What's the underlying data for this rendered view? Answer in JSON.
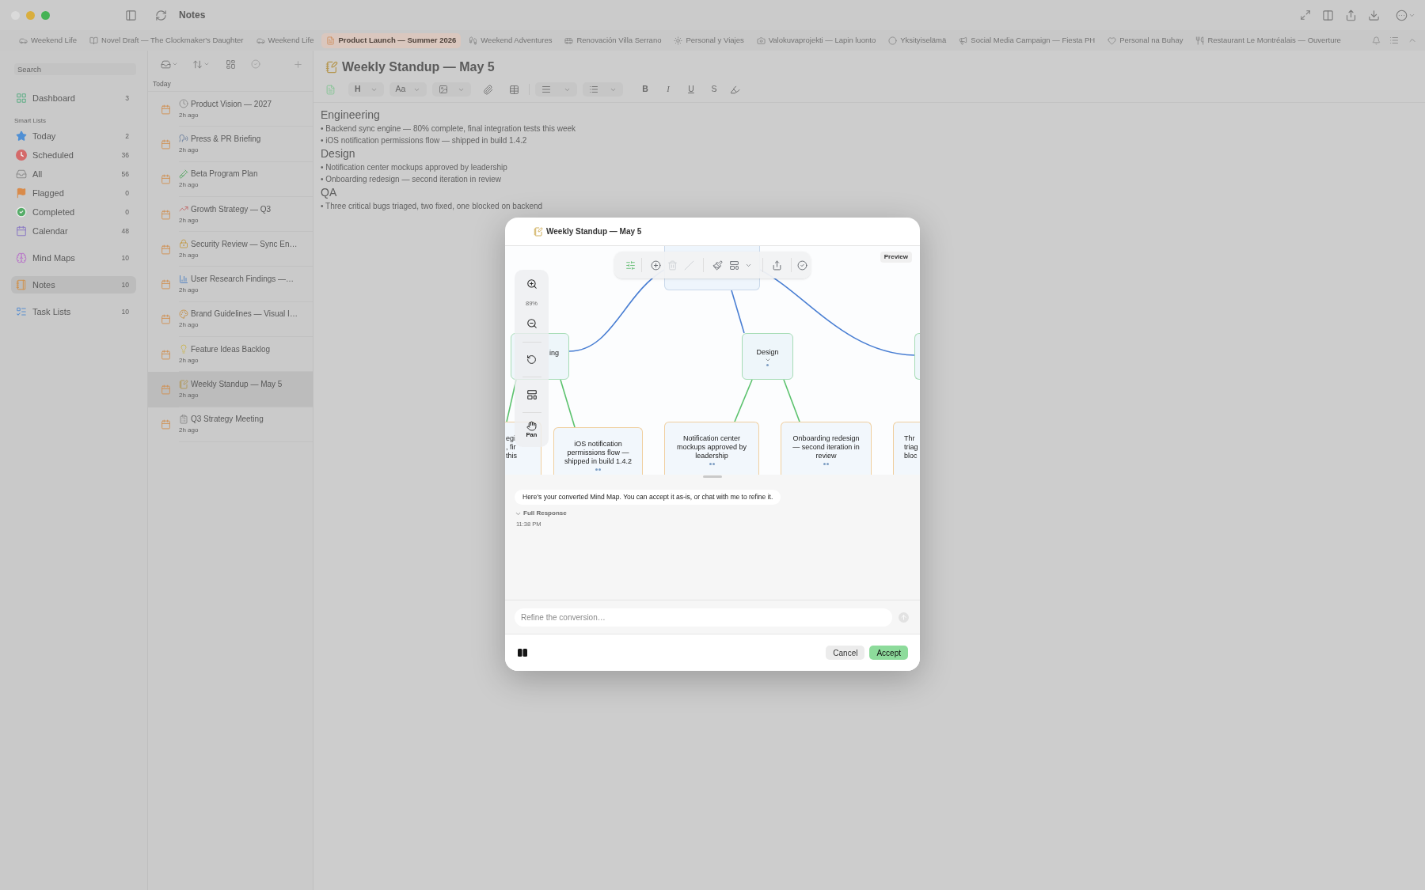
{
  "window": {
    "title": "Notes"
  },
  "tabs": [
    {
      "label": "Weekend Life",
      "selected": false
    },
    {
      "label": "Novel Draft — The Clockmaker's Daughter",
      "selected": false
    },
    {
      "label": "Weekend Life",
      "selected": false
    },
    {
      "label": "Product Launch — Summer 2026",
      "selected": true
    },
    {
      "label": "Weekend Adventures",
      "selected": false
    },
    {
      "label": "Renovación Villa Serrano",
      "selected": false
    },
    {
      "label": "Personal y Viajes",
      "selected": false
    },
    {
      "label": "Valokuvaprojekti — Lapin luonto",
      "selected": false
    },
    {
      "label": "Yksityiselämä",
      "selected": false
    },
    {
      "label": "Social Media Campaign — Fiesta PH",
      "selected": false
    },
    {
      "label": "Personal na Buhay",
      "selected": false
    },
    {
      "label": "Restaurant Le Montréalais — Ouverture",
      "selected": false
    }
  ],
  "sidebar": {
    "search": {
      "placeholder": "Search"
    },
    "groups": [
      {
        "items": [
          {
            "label": "Dashboard",
            "count": "3",
            "selected": false
          }
        ]
      },
      {
        "heading": "Smart Lists",
        "items": [
          {
            "label": "Today",
            "count": "2",
            "selected": false
          },
          {
            "label": "Scheduled",
            "count": "36",
            "selected": false
          },
          {
            "label": "All",
            "count": "56",
            "selected": false
          },
          {
            "label": "Flagged",
            "count": "0",
            "selected": false
          },
          {
            "label": "Completed",
            "count": "0",
            "selected": false
          },
          {
            "label": "Calendar",
            "count": "48",
            "selected": false
          }
        ]
      },
      {
        "items": [
          {
            "label": "Mind Maps",
            "count": "10",
            "selected": false
          }
        ]
      },
      {
        "items": [
          {
            "label": "Notes",
            "count": "10",
            "selected": true
          }
        ]
      },
      {
        "items": [
          {
            "label": "Task Lists",
            "count": "10",
            "selected": false
          }
        ]
      }
    ]
  },
  "notes_list": {
    "section": "Today",
    "items": [
      {
        "title": "Product Vision — 2027",
        "time": "2h ago",
        "selected": false
      },
      {
        "title": "Press & PR Briefing",
        "time": "2h ago",
        "selected": false
      },
      {
        "title": "Beta Program Plan",
        "time": "2h ago",
        "selected": false
      },
      {
        "title": "Growth Strategy — Q3",
        "time": "2h ago",
        "selected": false
      },
      {
        "title": "Security Review — Sync En…",
        "time": "2h ago",
        "selected": false
      },
      {
        "title": "User Research Findings —…",
        "time": "2h ago",
        "selected": false
      },
      {
        "title": "Brand Guidelines — Visual I…",
        "time": "2h ago",
        "selected": false
      },
      {
        "title": "Feature Ideas Backlog",
        "time": "2h ago",
        "selected": false
      },
      {
        "title": "Weekly Standup — May 5",
        "time": "2h ago",
        "selected": true
      },
      {
        "title": "Q3 Strategy Meeting",
        "time": "2h ago",
        "selected": false
      }
    ]
  },
  "editor": {
    "title": "Weekly Standup — May 5",
    "toolbar": {
      "heading_menu": "H",
      "font_menu": "Aa",
      "styles": [
        "B",
        "I",
        "U",
        "S"
      ]
    },
    "content": [
      {
        "kind": "heading",
        "text": "Engineering"
      },
      {
        "kind": "bullet",
        "text": "• Backend sync engine — 80% complete, final integration tests this week"
      },
      {
        "kind": "bullet",
        "text": "• iOS notification permissions flow — shipped in build 1.4.2"
      },
      {
        "kind": "heading",
        "text": "Design"
      },
      {
        "kind": "bullet",
        "text": "• Notification center mockups approved by leadership"
      },
      {
        "kind": "bullet",
        "text": "• Onboarding redesign — second iteration in review"
      },
      {
        "kind": "heading",
        "text": "QA"
      },
      {
        "kind": "bullet",
        "text": "• Three critical bugs triaged, two fixed, one blocked on backend"
      }
    ]
  },
  "dialog": {
    "title": "Weekly Standup — May 5",
    "badge": "Preview",
    "map_tools": [
      {
        "disabled": false
      },
      {
        "disabled": false
      },
      {
        "disabled": true
      },
      {
        "disabled": true
      },
      {
        "disabled": false
      },
      {
        "disabled": false
      },
      {
        "disabled": false
      },
      {
        "disabled": false
      }
    ],
    "zoom_level": "89%",
    "pan_label": "Pan",
    "mind_map": {
      "branches": [
        {
          "lines": [
            "ing"
          ]
        },
        {
          "lines": [
            "Design"
          ]
        }
      ],
      "leaves": [
        {
          "lines": [
            "egi",
            ", fir",
            "this"
          ]
        },
        {
          "lines": [
            "iOS notification",
            "permissions flow —",
            "shipped in build 1.4.2"
          ]
        },
        {
          "lines": [
            "Notification center",
            "mockups approved by",
            "leadership"
          ]
        },
        {
          "lines": [
            "Onboarding redesign",
            "— second iteration in",
            "review"
          ]
        },
        {
          "lines": [
            "Thr",
            "triag",
            "bloc"
          ]
        }
      ]
    },
    "message": "Here's your converted Mind Map. You can accept it as-is, or chat with me to refine it.",
    "disclosure": "Full Response",
    "time": "11:38 PM",
    "input": {
      "placeholder": "Refine the conversion…"
    },
    "send_button": {
      "disabled": true
    },
    "buttons": [
      {
        "label": "Cancel",
        "kind": "secondary"
      },
      {
        "label": "Accept",
        "kind": "primary"
      }
    ]
  }
}
